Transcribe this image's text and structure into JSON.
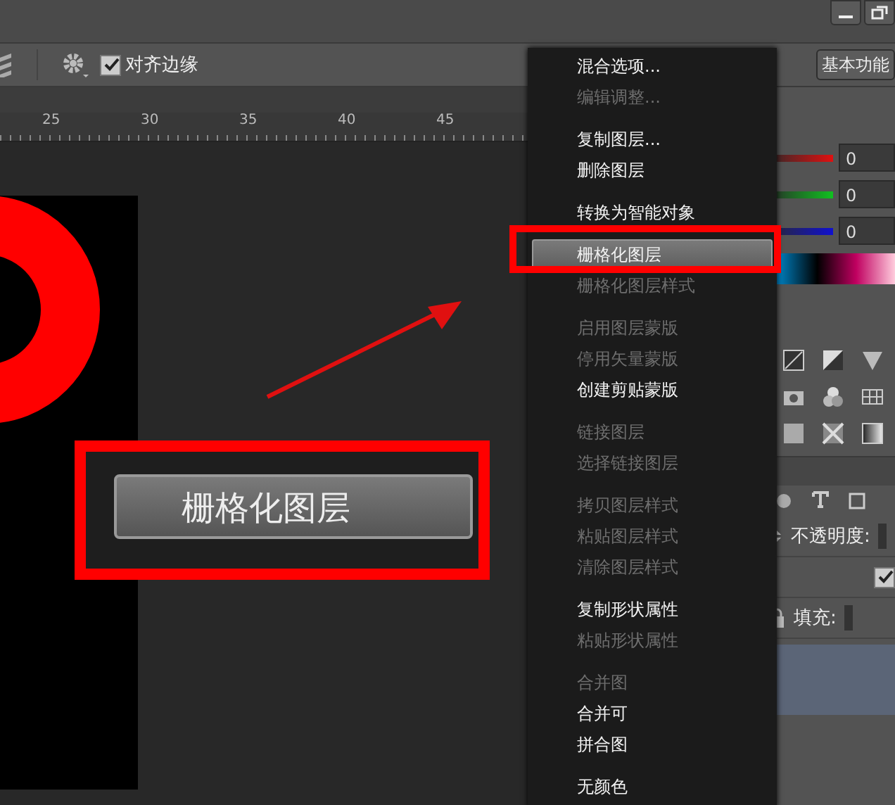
{
  "options_bar": {
    "snap_edges": {
      "label": "对齐边缘",
      "checked": true
    },
    "workspace_button": "基本功能"
  },
  "ruler": {
    "ticks": [
      "25",
      "30",
      "35",
      "40",
      "45"
    ]
  },
  "color_panel": {
    "fields": [
      "0",
      "0",
      "0"
    ]
  },
  "layers_panel": {
    "opacity_label": "不透明度:",
    "lock_checked": true,
    "fill_label": "填充:"
  },
  "context_menu": {
    "groups": [
      [
        {
          "label": "混合选项...",
          "disabled": false,
          "selected": false
        },
        {
          "label": "编辑调整...",
          "disabled": true,
          "selected": false
        }
      ],
      [
        {
          "label": "复制图层...",
          "disabled": false,
          "selected": false
        },
        {
          "label": "删除图层",
          "disabled": false,
          "selected": false
        }
      ],
      [
        {
          "label": "转换为智能对象",
          "disabled": false,
          "selected": false
        }
      ],
      [
        {
          "label": "栅格化图层",
          "disabled": false,
          "selected": true
        },
        {
          "label": "栅格化图层样式",
          "disabled": true,
          "selected": false
        }
      ],
      [
        {
          "label": "启用图层蒙版",
          "disabled": true,
          "selected": false
        },
        {
          "label": "停用矢量蒙版",
          "disabled": true,
          "selected": false
        },
        {
          "label": "创建剪贴蒙版",
          "disabled": false,
          "selected": false
        }
      ],
      [
        {
          "label": "链接图层",
          "disabled": true,
          "selected": false
        },
        {
          "label": "选择链接图层",
          "disabled": true,
          "selected": false
        }
      ],
      [
        {
          "label": "拷贝图层样式",
          "disabled": true,
          "selected": false
        },
        {
          "label": "粘贴图层样式",
          "disabled": true,
          "selected": false
        },
        {
          "label": "清除图层样式",
          "disabled": true,
          "selected": false
        }
      ],
      [
        {
          "label": "复制形状属性",
          "disabled": false,
          "selected": false
        },
        {
          "label": "粘贴形状属性",
          "disabled": true,
          "selected": false
        }
      ],
      [
        {
          "label": "合并图",
          "disabled": true,
          "selected": false
        },
        {
          "label": "合并可",
          "disabled": false,
          "selected": false
        },
        {
          "label": "拼合图",
          "disabled": false,
          "selected": false
        }
      ],
      [
        {
          "label": "无颜色",
          "disabled": false,
          "selected": false
        }
      ]
    ]
  },
  "callout": {
    "label": "栅格化图层"
  }
}
